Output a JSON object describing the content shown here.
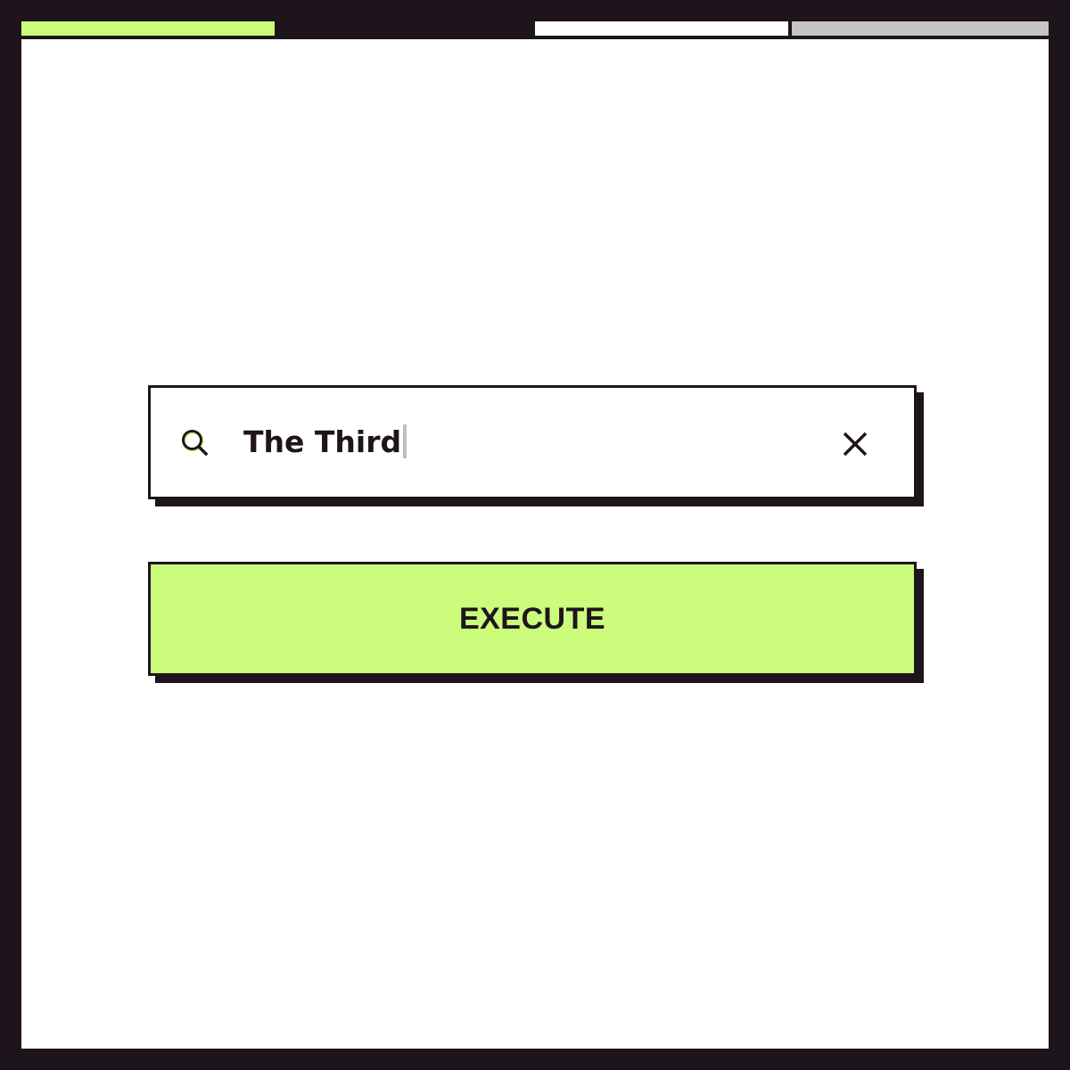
{
  "progress": {
    "fraction": 0.25,
    "accent_color": "#ccfc7c",
    "segment_colors": [
      "#ffffff",
      "#c4c4c4"
    ]
  },
  "search": {
    "value": "The Third",
    "icon": "search-icon",
    "clear_icon": "close-icon"
  },
  "execute": {
    "label": "EXECUTE",
    "background": "#ccfc7c"
  },
  "colors": {
    "frame": "#1e151c",
    "canvas": "#ffffff"
  }
}
